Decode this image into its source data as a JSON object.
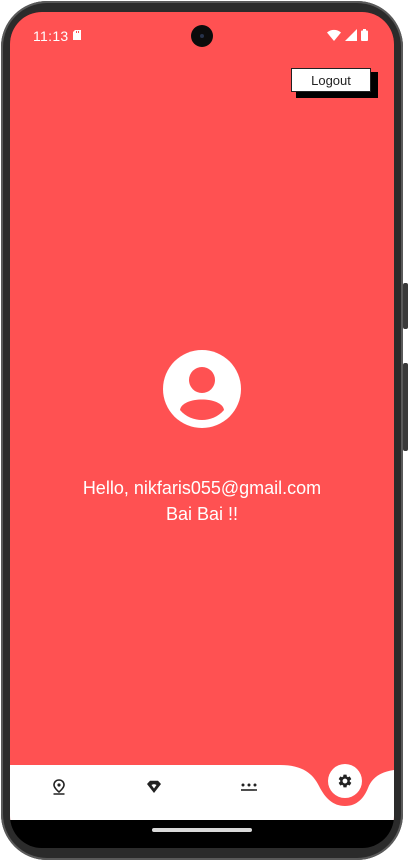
{
  "status_bar": {
    "time": "11:13",
    "icons": [
      "sd-card-icon",
      "wifi-icon",
      "signal-icon",
      "battery-icon"
    ]
  },
  "header": {
    "logout_label": "Logout"
  },
  "profile": {
    "avatar_icon": "account-circle-icon",
    "greeting": "Hello, nikfaris055@gmail.com",
    "message": "Bai Bai !!"
  },
  "bottom_nav": {
    "items": [
      {
        "icon": "location-pin-icon"
      },
      {
        "icon": "wifi-diamond-icon"
      },
      {
        "icon": "dots-icon"
      }
    ],
    "fab_icon": "settings-gear-icon"
  },
  "colors": {
    "background": "#ff5152",
    "button_bg": "#ffffff",
    "text_light": "#ffffff",
    "icon_dark": "#222222"
  }
}
